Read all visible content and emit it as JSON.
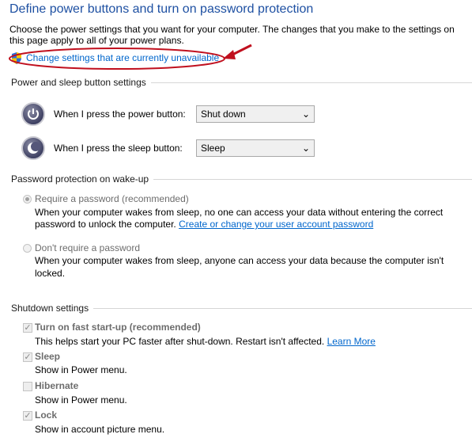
{
  "title": "Define power buttons and turn on password protection",
  "intro": [
    "Choose the power settings that you want for your computer. The changes that you make to the settings on",
    "this page apply to all of your power plans."
  ],
  "change_link": "Change settings that are currently unavailable",
  "annotation_color": "#c0101e",
  "power_section": {
    "heading": "Power and sleep button settings",
    "rows": [
      {
        "label": "When I press the power button:",
        "value": "Shut down",
        "icon": "power-icon"
      },
      {
        "label": "When I press the sleep button:",
        "value": "Sleep",
        "icon": "sleep-moon-icon"
      }
    ]
  },
  "password_section": {
    "heading": "Password protection on wake-up",
    "options": [
      {
        "label": "Require a password (recommended)",
        "selected": true,
        "desc": [
          "When your computer wakes from sleep, no one can access your data without entering the correct",
          "password to unlock the computer. "
        ],
        "link": "Create or change your user account password"
      },
      {
        "label": "Don't require a password",
        "selected": false,
        "desc": [
          "When your computer wakes from sleep, anyone can access your data because the computer isn't",
          "locked."
        ]
      }
    ]
  },
  "shutdown_section": {
    "heading": "Shutdown settings",
    "items": [
      {
        "label": "Turn on fast start-up (recommended)",
        "checked": true,
        "desc": "This helps start your PC faster after shut-down. Restart isn't affected. ",
        "link": "Learn More"
      },
      {
        "label": "Sleep",
        "checked": true,
        "desc": "Show in Power menu."
      },
      {
        "label": "Hibernate",
        "checked": false,
        "desc": "Show in Power menu."
      },
      {
        "label": "Lock",
        "checked": true,
        "desc": "Show in account picture menu."
      }
    ]
  }
}
